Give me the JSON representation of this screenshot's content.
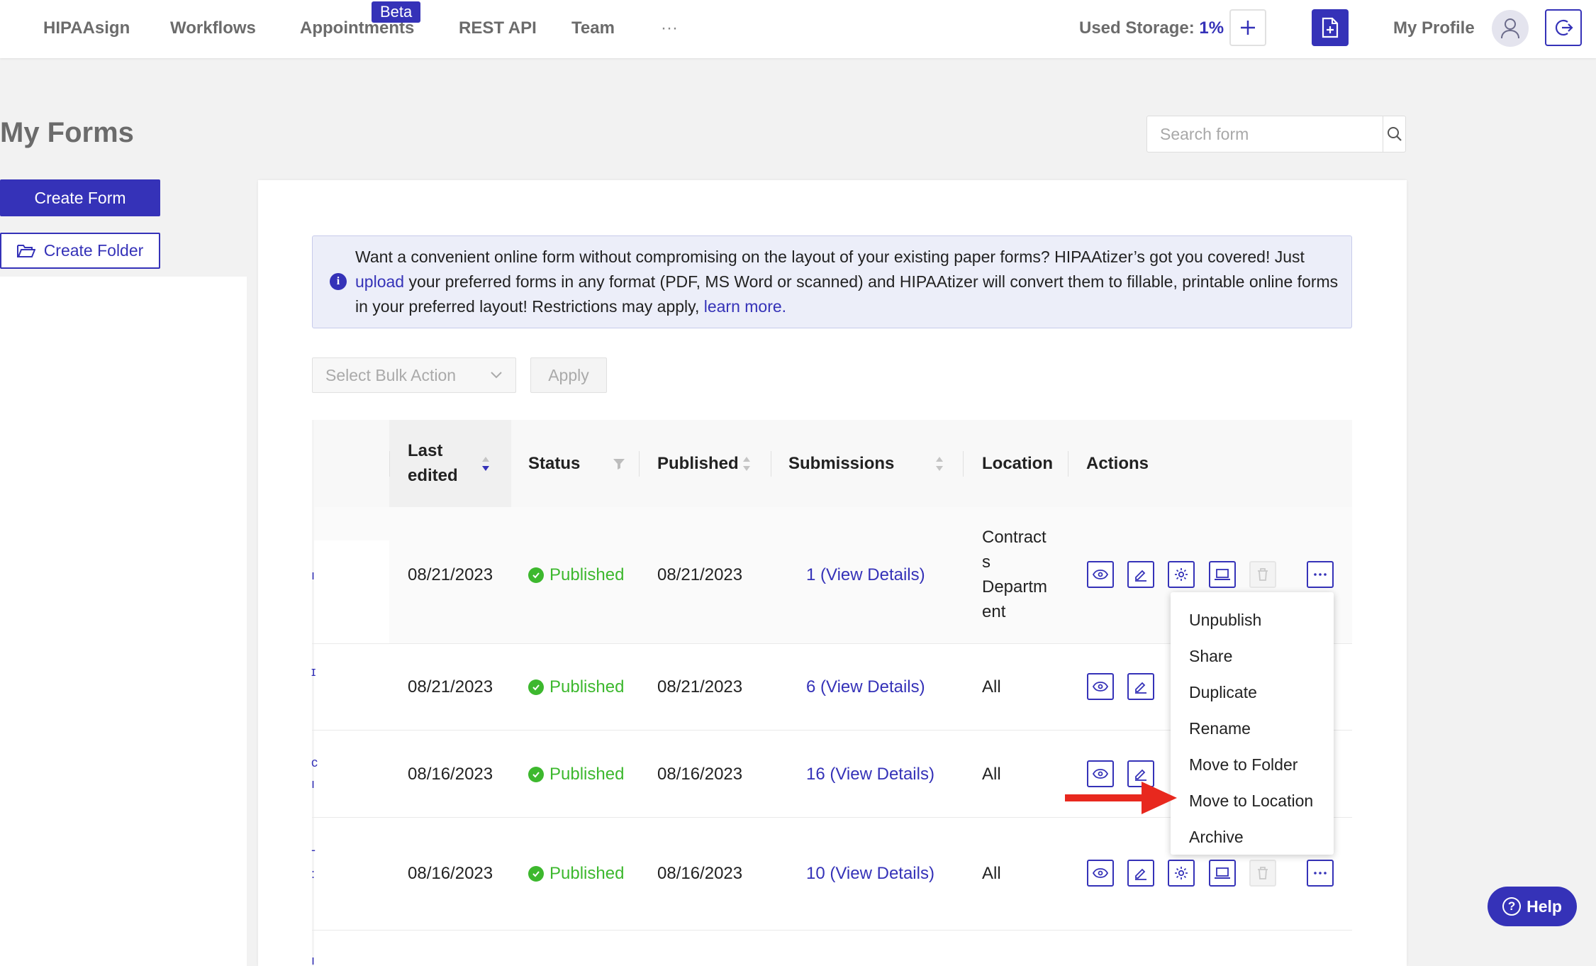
{
  "nav": {
    "items": [
      "HIPAAsign",
      "Workflows",
      "Appointments",
      "REST API",
      "Team"
    ],
    "more": "···",
    "beta_badge": "Beta",
    "storage_label": "Used Storage:",
    "storage_value": "1%",
    "profile_label": "My Profile"
  },
  "page": {
    "title": "My Forms",
    "search_placeholder": "Search form"
  },
  "sidebar": {
    "create_form": "Create Form",
    "create_folder": "Create Folder"
  },
  "banner": {
    "text_1": "Want a convenient online form without compromising on the layout of your existing paper forms? HIPAAtizer’s got you covered! Just",
    "upload_link": "upload",
    "text_2": "your preferred forms in any format (PDF, MS Word or scanned) and HIPAAtizer will convert them to fillable, printable online forms in your preferred layout! Restrictions may apply,",
    "learn_more_link": "learn more."
  },
  "bulk": {
    "select_placeholder": "Select Bulk Action",
    "apply": "Apply"
  },
  "table": {
    "headers": {
      "last_edited_1": "Last",
      "last_edited_2": "edited",
      "status": "Status",
      "published": "Published",
      "submissions": "Submissions",
      "location": "Location",
      "actions": "Actions"
    },
    "rows": [
      {
        "last_edited": "08/21/2023",
        "status": "Published",
        "published": "08/21/2023",
        "submissions": "1 (View Details)",
        "location_lines": [
          "Contract",
          "s",
          "Departm",
          "ent"
        ]
      },
      {
        "last_edited": "08/21/2023",
        "status": "Published",
        "published": "08/21/2023",
        "submissions": "6 (View Details)",
        "location": "All"
      },
      {
        "last_edited": "08/16/2023",
        "status": "Published",
        "published": "08/16/2023",
        "submissions": "16 (View Details)",
        "location": "All"
      },
      {
        "last_edited": "08/16/2023",
        "status": "Published",
        "published": "08/16/2023",
        "submissions": "10 (View Details)",
        "location": "All"
      }
    ]
  },
  "dropdown": {
    "items": [
      "Unpublish",
      "Share",
      "Duplicate",
      "Rename",
      "Move to Folder",
      "Move to Location",
      "Archive"
    ]
  },
  "help": {
    "label": "Help"
  },
  "colors": {
    "brand": "#3532b8",
    "success": "#3db82e",
    "annotation_arrow": "#e8281e"
  }
}
